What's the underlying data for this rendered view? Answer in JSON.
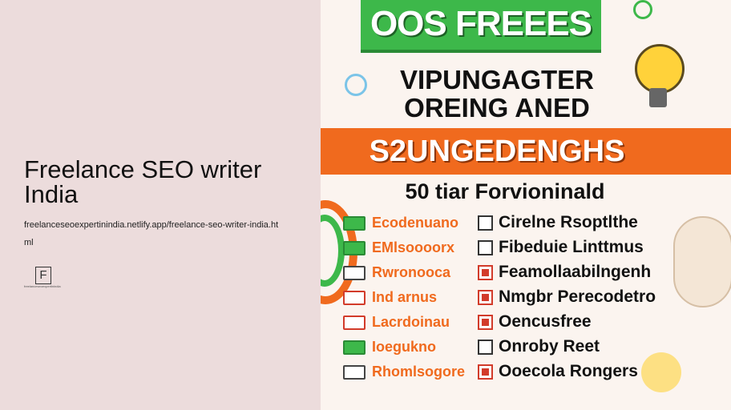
{
  "page": {
    "title": "Freelance SEO writer India",
    "url": "freelanceseoexpertinindia.netlify.app/freelance-seo-writer-india.html",
    "logo_letter": "F",
    "logo_caption": "freelanceseoexpertinindia"
  },
  "poster": {
    "top_banner": "OOS FREEES",
    "headline_1": "VIPUNGAGTER",
    "headline_2": "OREING ANED",
    "band_text": "S2UNGEDENGHS",
    "subhead": "50 tiar Forvioninald",
    "rows": [
      {
        "left": "Ecodenuano",
        "right": "Cirelne Rsoptlthe",
        "checked": false,
        "left_icon": "green"
      },
      {
        "left": "EMlsoooorx",
        "right": "Fibeduie Linttmus",
        "checked": false,
        "left_icon": "green"
      },
      {
        "left": "Rwronooca",
        "right": "Feamollaabilngenh",
        "checked": true,
        "left_icon": "plain"
      },
      {
        "left": "Ind arnus",
        "right": "Nmgbr Perecodetro",
        "checked": true,
        "left_icon": "red"
      },
      {
        "left": "Lacrdoinau",
        "right": "Oencusfree",
        "checked": true,
        "left_icon": "red"
      },
      {
        "left": "Ioegukno",
        "right": "Onroby Reet",
        "checked": false,
        "left_icon": "green"
      },
      {
        "left": "Rhomlsogore",
        "right": "Ooecola Rongers",
        "checked": true,
        "left_icon": "plain"
      }
    ]
  }
}
